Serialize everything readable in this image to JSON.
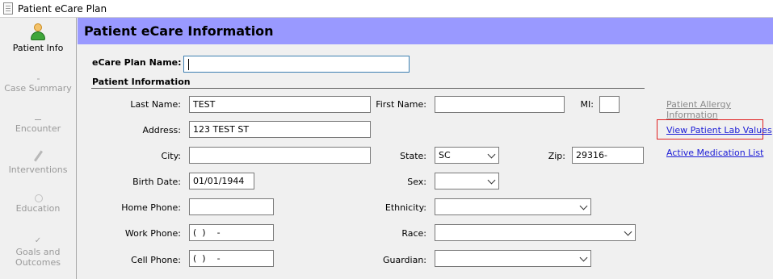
{
  "window": {
    "title": "Patient eCare Plan"
  },
  "sidebar": {
    "items": [
      {
        "label": "Patient Info",
        "icon": "person-icon",
        "active": true
      },
      {
        "label": "Case Summary",
        "icon": "case-summary-icon",
        "active": false
      },
      {
        "label": "Encounter",
        "icon": "encounter-icon",
        "active": false
      },
      {
        "label": "Interventions",
        "icon": "interventions-icon",
        "active": false
      },
      {
        "label": "Education",
        "icon": "education-icon",
        "active": false
      },
      {
        "label": "Goals and",
        "label2": "Outcomes",
        "icon": "goals-outcomes-icon",
        "active": false
      }
    ]
  },
  "header": {
    "title": "Patient eCare Information"
  },
  "form": {
    "plan_name_label": "eCare Plan Name:",
    "plan_name_value": "",
    "section_label": "Patient Information",
    "last_name_label": "Last Name:",
    "last_name_value": "TEST",
    "first_name_label": "First Name:",
    "first_name_value": "",
    "mi_label": "MI:",
    "mi_value": "",
    "address_label": "Address:",
    "address_value": "123 TEST ST",
    "city_label": "City:",
    "city_value": "",
    "state_label": "State:",
    "state_value": "SC",
    "zip_label": "Zip:",
    "zip_value": "29316-",
    "birth_date_label": "Birth Date:",
    "birth_date_value": "01/01/1944",
    "sex_label": "Sex:",
    "sex_value": "",
    "home_phone_label": "Home Phone:",
    "home_phone_value": "",
    "ethnicity_label": "Ethnicity:",
    "ethnicity_value": "",
    "work_phone_label": "Work Phone:",
    "work_phone_value": "(  )    -",
    "race_label": "Race:",
    "race_value": "",
    "cell_phone_label": "Cell Phone:",
    "cell_phone_value": "(  )    -",
    "guardian_label": "Guardian:",
    "guardian_value": ""
  },
  "links": {
    "allergy": "Patient Allergy Information",
    "lab_values": "View Patient Lab Values",
    "medication": "Active Medication List"
  },
  "colors": {
    "header_bg": "#9999ff",
    "link_active": "#1b1bd6",
    "link_disabled": "#8a8a8a",
    "highlight_border": "#e02020"
  }
}
